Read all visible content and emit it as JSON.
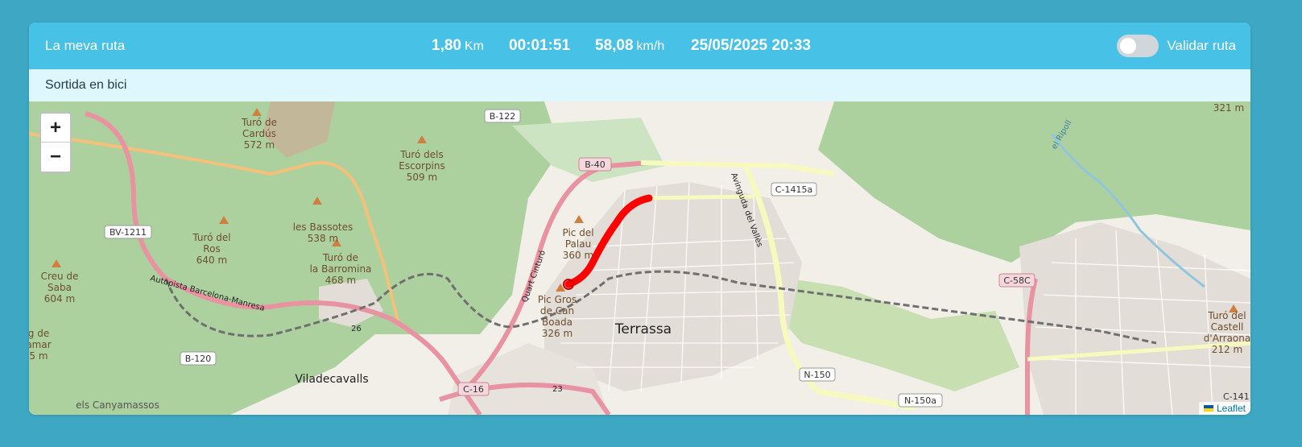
{
  "header": {
    "route_name": "La meva ruta",
    "distance_value": "1,80",
    "distance_unit": "Km",
    "duration": "00:01:51",
    "speed_value": "58,08",
    "speed_unit": "km/h",
    "datetime": "25/05/2025 20:33",
    "validate_label": "Validar ruta",
    "validate_on": false
  },
  "subheader": {
    "description": "Sortida en bici"
  },
  "map": {
    "zoom_in": "+",
    "zoom_out": "−",
    "attribution": "Leaflet",
    "route_color": "#ff0000",
    "labels": {
      "turo_cardus": "Turó de",
      "turo_cardus2": "Cardús",
      "turo_cardus_alt": "572 m",
      "turo_escorpins": "Turó dels",
      "turo_escorpins2": "Escorpins",
      "turo_escorpins_alt": "509 m",
      "b122": "B-122",
      "b40": "B-40",
      "c1415a": "C-1415a",
      "bv1211": "BV-1211",
      "turo_ros": "Turó del",
      "turo_ros2": "Ros",
      "turo_ros_alt": "640 m",
      "bassotes": "les Bassotes",
      "bassotes_alt": "538 m",
      "barromina": "Turó de",
      "barromina2": "la Barromina",
      "barromina_alt": "468 m",
      "creu_saba": "Creu de",
      "creu_saba2": "Saba",
      "creu_saba_alt": "604 m",
      "pic_palau": "Pic del",
      "pic_palau2": "Palau",
      "pic_palau_alt": "360 m",
      "pic_gros": "Pic Gros",
      "pic_gros2": "de Can",
      "pic_gros3": "Boada",
      "pic_gros_alt": "326 m",
      "terrassa": "Terrassa",
      "viladecavalls": "Viladecavalls",
      "b120": "B-120",
      "c16": "C-16",
      "n150": "N-150",
      "n150a": "N-150a",
      "c58c": "C-58C",
      "castell": "Turó del",
      "castell2": "Castell",
      "castell3": "d'Arraona",
      "castell_alt": "212 m",
      "alt321": "321 m",
      "autopista": "Autopista Barcelona-Manresa",
      "quart": "Quart Cinturó",
      "avinguda": "Avinguda del Vallès",
      "canyamassos": "els Canyamassos",
      "n26": "26",
      "n23": "23",
      "ripoll": "el Ripoll",
      "edge_left1": "g de",
      "edge_left2": "amar",
      "edge_left3": "5 m",
      "c141": "C-141"
    }
  }
}
